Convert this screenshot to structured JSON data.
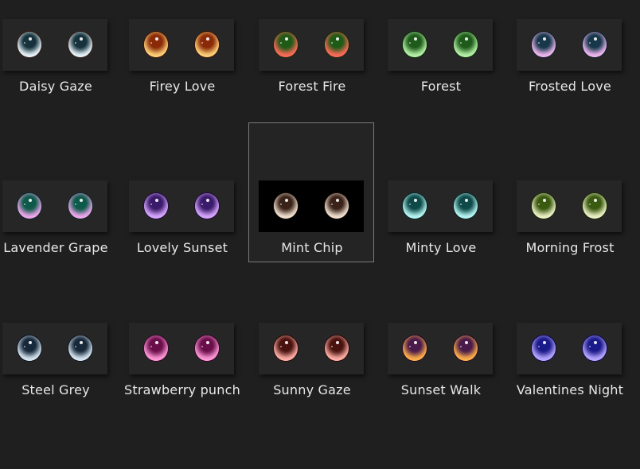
{
  "items": [
    {
      "label": "Daisy Gaze",
      "top": "#16323c",
      "bottom": "#e8f4fa",
      "rim": "#3a1e12"
    },
    {
      "label": "Firey Love",
      "top": "#8a2a08",
      "bottom": "#ffd27a",
      "rim": "#3a1406"
    },
    {
      "label": "Forest Fire",
      "top": "#1f5a16",
      "bottom": "#ff6a5a",
      "rim": "#122a0c"
    },
    {
      "label": "Forest",
      "top": "#1e5a1a",
      "bottom": "#b6f2a8",
      "rim": "#0e2a0c"
    },
    {
      "label": "Frosted Love",
      "top": "#16384a",
      "bottom": "#f0b8f0",
      "rim": "#0c1e28"
    },
    {
      "label": "Lavender Grape",
      "top": "#0e5a4a",
      "bottom": "#f2a8f0",
      "rim": "#0a2a24"
    },
    {
      "label": "Lovely Sunset",
      "top": "#3a1a6a",
      "bottom": "#d8a8ff",
      "rim": "#1c0c36"
    },
    {
      "label": "Mint Chip",
      "top": "#3a2218",
      "bottom": "#f2e2d2",
      "rim": "#1c100a"
    },
    {
      "label": "Minty Love",
      "top": "#0e4a4a",
      "bottom": "#b8f8f4",
      "rim": "#0a2424"
    },
    {
      "label": "Morning Frost",
      "top": "#3a5a10",
      "bottom": "#eef2c8",
      "rim": "#1c2a08"
    },
    {
      "label": "Steel Grey",
      "top": "#16283a",
      "bottom": "#d8e6f2",
      "rim": "#0c141c"
    },
    {
      "label": "Strawberry punch",
      "top": "#6a0e4a",
      "bottom": "#ff9ad8",
      "rim": "#360828"
    },
    {
      "label": "Sunny Gaze",
      "top": "#4a120e",
      "bottom": "#ffb0a8",
      "rim": "#260a08"
    },
    {
      "label": "Sunset Walk",
      "top": "#4a1a4a",
      "bottom": "#ffb04a",
      "rim": "#260c26"
    },
    {
      "label": "Valentines Night",
      "top": "#1a1a8a",
      "bottom": "#b8a8ff",
      "rim": "#0c0c48"
    }
  ],
  "selected_label": "Mint Chip"
}
